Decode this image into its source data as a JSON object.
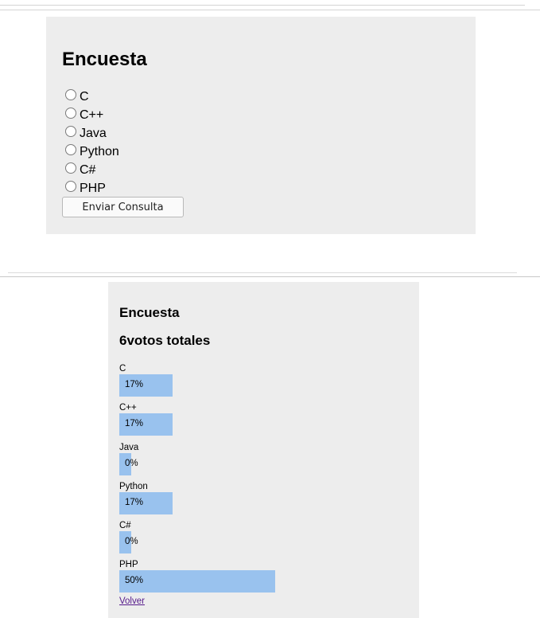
{
  "survey": {
    "title": "Encuesta",
    "options": [
      "C",
      "C++",
      "Java",
      "Python",
      "C#",
      "PHP"
    ],
    "submit_label": "Enviar Consulta"
  },
  "results": {
    "title": "Encuesta",
    "total_votes": "6",
    "total_suffix": "votos totales",
    "items": [
      {
        "label": "C",
        "percent": 17,
        "percent_text": "17%"
      },
      {
        "label": "C++",
        "percent": 17,
        "percent_text": "17%"
      },
      {
        "label": "Java",
        "percent": 0,
        "percent_text": "0%"
      },
      {
        "label": "Python",
        "percent": 17,
        "percent_text": "17%"
      },
      {
        "label": "C#",
        "percent": 0,
        "percent_text": "0%"
      },
      {
        "label": "PHP",
        "percent": 50,
        "percent_text": "50%"
      }
    ],
    "back_link": "Volver",
    "bar_color": "#99c2ee"
  }
}
